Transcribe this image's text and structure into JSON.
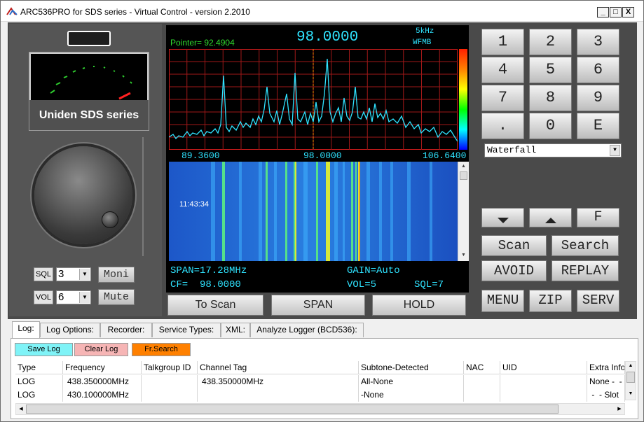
{
  "window": {
    "title": "ARC536PRO for SDS series - Virtual Control  -  version 2.2010",
    "min": "_",
    "max": "□",
    "close": "X"
  },
  "left_panel": {
    "meter_label": "Uniden SDS series",
    "sql_label": "SQL",
    "sql_value": "3",
    "vol_label": "VOL",
    "vol_value": "6",
    "moni": "Moni",
    "mute": "Mute"
  },
  "display": {
    "pointer": "Pointer= 92.4904",
    "frequency": "98.0000",
    "step": "5kHz",
    "mode": "WFMB",
    "scale": [
      "89.3600",
      "98.0000",
      "106.6400"
    ],
    "time": "11:43:34",
    "span": "SPAN=17.28MHz",
    "gain": "GAIN=Auto",
    "cf": "CF=  98.0000",
    "vol": "VOL=5",
    "sql": "SQL=7"
  },
  "center_buttons": [
    "To Scan",
    "SPAN",
    "HOLD"
  ],
  "keypad": [
    "1",
    "2",
    "3",
    "4",
    "5",
    "6",
    "7",
    "8",
    "9",
    ".",
    "0",
    "E"
  ],
  "view_select": "Waterfall",
  "right_buttons": {
    "f": "F",
    "scan": "Scan",
    "search": "Search",
    "avoid": "AVOID",
    "replay": "REPLAY",
    "menu": "MENU",
    "zip": "ZIP",
    "serv": "SERV"
  },
  "tabs": [
    "Log:",
    "Log Options:",
    "Recorder:",
    "Service Types:",
    "XML:",
    "Analyze Logger (BCD536):"
  ],
  "log_buttons": {
    "save": "Save Log",
    "clear": "Clear Log",
    "search": "Fr.Search"
  },
  "log_table": {
    "headers": [
      "Type",
      "Frequency",
      "Talkgroup ID",
      "Channel Tag",
      "Subtone-Detected",
      "NAC",
      "UID",
      "Extra Info"
    ],
    "rows": [
      [
        "LOG",
        "438.350000MHz",
        "",
        "438.350000MHz",
        "All-None",
        "",
        "",
        "None -  -"
      ],
      [
        "LOG",
        "430.100000MHz",
        "",
        "",
        "-None",
        "",
        "",
        " -  - Slot"
      ]
    ]
  },
  "colors": {
    "display_cyan": "#2fe3ff",
    "pointer_green": "#2fdc2f",
    "save_btn": "#7ff3f7",
    "clear_btn": "#f6b5b5",
    "search_btn": "#ff8000"
  }
}
